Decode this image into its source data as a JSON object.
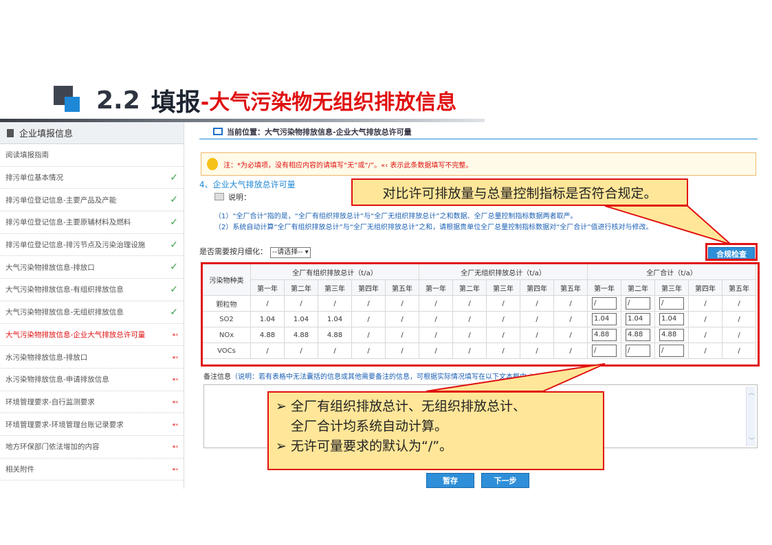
{
  "slide": {
    "section_number": "2.2",
    "title_main": "填报",
    "title_sub": "-大气污染物无组织排放信息"
  },
  "sidebar": {
    "header": "企业填报信息",
    "items": [
      {
        "label": "阅读填报指南",
        "status": "none"
      },
      {
        "label": "排污单位基本情况",
        "status": "ok"
      },
      {
        "label": "排污单位登记信息-主要产品及产能",
        "status": "ok"
      },
      {
        "label": "排污单位登记信息-主要原辅材料及燃料",
        "status": "ok"
      },
      {
        "label": "排污单位登记信息-排污节点及污染治理设施",
        "status": "ok"
      },
      {
        "label": "大气污染物排放信息-排放口",
        "status": "ok"
      },
      {
        "label": "大气污染物排放信息-有组织排放信息",
        "status": "ok"
      },
      {
        "label": "大气污染物排放信息-无组织排放信息",
        "status": "ok"
      },
      {
        "label": "大气污染物排放信息-企业大气排放总许可量",
        "status": "warn"
      },
      {
        "label": "水污染物排放信息-排放口",
        "status": "warn"
      },
      {
        "label": "水污染物排放信息-申请排放信息",
        "status": "warn"
      },
      {
        "label": "环境管理要求-自行监测要求",
        "status": "warn"
      },
      {
        "label": "环境管理要求-环境管理台账记录要求",
        "status": "warn"
      },
      {
        "label": "地方环保部门依法增加的内容",
        "status": "warn"
      },
      {
        "label": "相关附件",
        "status": "warn"
      }
    ],
    "ok_glyph": "✓",
    "warn_glyph": "«‹"
  },
  "main": {
    "breadcrumb": "当前位置：大气污染物排放信息-企业大气排放总许可量",
    "notice": "注：*为必填项，没有相应内容的请填写“无”或“/”。«‹ 表示此条数据填写不完整。",
    "section_title": "4、企业大气排放总许可量",
    "explain_label": "说明：",
    "note1": "（1）“全厂合计”指的是，“全厂有组织排放总计”与“全厂无组织排放总计”之和数据、全厂总量控制指标数据两者取严。",
    "note2": "（2）系统自动计算“全厂有组织排放总计”与“全厂无组织排放总计”之和，请根据贵单位全厂总量控制指标数据对“全厂合计”值进行核对与修改。",
    "monthly_label": "是否需要按月细化：",
    "monthly_select": "--请选择-- ▾",
    "check_button": "合规检查",
    "table": {
      "pollutant_header": "污染物种类",
      "groups": [
        "全厂有组织排放总计（t/a）",
        "全厂无组织排放总计（t/a）",
        "全厂合计（t/a）"
      ],
      "years": [
        "第一年",
        "第二年",
        "第三年",
        "第四年",
        "第五年"
      ],
      "rows": [
        {
          "name": "颗粒物",
          "organized": [
            "/",
            "/",
            "/",
            "/",
            "/"
          ],
          "unorganized": [
            "/",
            "/",
            "/",
            "/",
            "/"
          ],
          "total": [
            "/",
            "/",
            "/",
            "/",
            "/"
          ]
        },
        {
          "name": "SO2",
          "organized": [
            "1.04",
            "1.04",
            "1.04",
            "/",
            "/"
          ],
          "unorganized": [
            "/",
            "/",
            "/",
            "/",
            "/"
          ],
          "total": [
            "1.04",
            "1.04",
            "1.04",
            "/",
            "/"
          ]
        },
        {
          "name": "NOx",
          "organized": [
            "4.88",
            "4.88",
            "4.88",
            "/",
            "/"
          ],
          "unorganized": [
            "/",
            "/",
            "/",
            "/",
            "/"
          ],
          "total": [
            "4.88",
            "4.88",
            "4.88",
            "/",
            "/"
          ]
        },
        {
          "name": "VOCs",
          "organized": [
            "/",
            "/",
            "/",
            "/",
            "/"
          ],
          "unorganized": [
            "/",
            "/",
            "/",
            "/",
            "/"
          ],
          "total": [
            "/",
            "/",
            "/",
            "/",
            "/"
          ]
        }
      ]
    },
    "remarks_label": "备注信息",
    "remarks_hint": "（说明：若有表格中无法囊括的信息或其他需要备注的信息，可根据实际情况填写在以下文本框中。）",
    "save_button": "暂存",
    "next_button": "下一步"
  },
  "callouts": {
    "top": "对比许可排放量与总量控制指标是否符合规定。",
    "bottom_bullet": "➢",
    "bottom_line1": "全厂有组织排放总计、无组织排放总计、",
    "bottom_line2": "全厂合计均系统自动计算。",
    "bottom_line3": "无许可量要求的默认为“/”。"
  },
  "colors": {
    "accent_blue": "#1e88d6",
    "alert_red": "#e01010",
    "callout_fill": "#ffe698",
    "ok_green": "#3aa14a"
  }
}
